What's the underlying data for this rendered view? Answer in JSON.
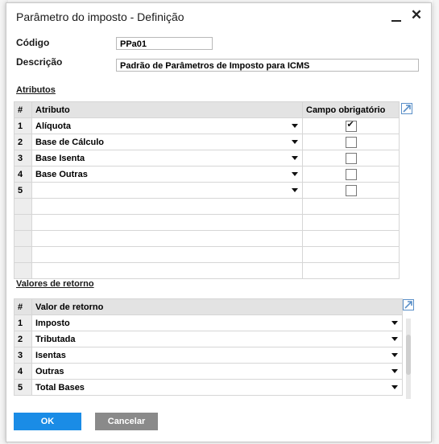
{
  "window": {
    "title": "Parâmetro do imposto - Definição",
    "minimize_label": "_",
    "close_label": "✕"
  },
  "form": {
    "code_label": "Código",
    "code_value": "PPa01",
    "description_label": "Descrição",
    "description_value": "Padrão de Parâmetros de Imposto para ICMS"
  },
  "attributes": {
    "section_title": "Atributos",
    "columns": [
      "#",
      "Atributo",
      "Campo obrigatório"
    ],
    "rows": [
      {
        "num": "1",
        "name": "Alíquota",
        "required": true
      },
      {
        "num": "2",
        "name": "Base de Cálculo",
        "required": false
      },
      {
        "num": "3",
        "name": "Base Isenta",
        "required": false
      },
      {
        "num": "4",
        "name": "Base Outras",
        "required": false
      },
      {
        "num": "5",
        "name": "",
        "required": false
      }
    ]
  },
  "return_values": {
    "section_title": "Valores de retorno",
    "columns": [
      "#",
      "Valor de retorno"
    ],
    "rows": [
      {
        "num": "1",
        "name": "Imposto"
      },
      {
        "num": "2",
        "name": "Tributada"
      },
      {
        "num": "3",
        "name": "Isentas"
      },
      {
        "num": "4",
        "name": "Outras"
      },
      {
        "num": "5",
        "name": "Total Bases"
      }
    ]
  },
  "buttons": {
    "ok": "OK",
    "cancel": "Cancelar"
  },
  "colors": {
    "ok_button": "#1a8ce6",
    "cancel_button": "#8a8a8a",
    "expand_icon": "#5a8fc8"
  },
  "icons": {
    "dropdown": "triangle-down",
    "expand": "arrow-up-right",
    "checkbox": "checkmark"
  }
}
